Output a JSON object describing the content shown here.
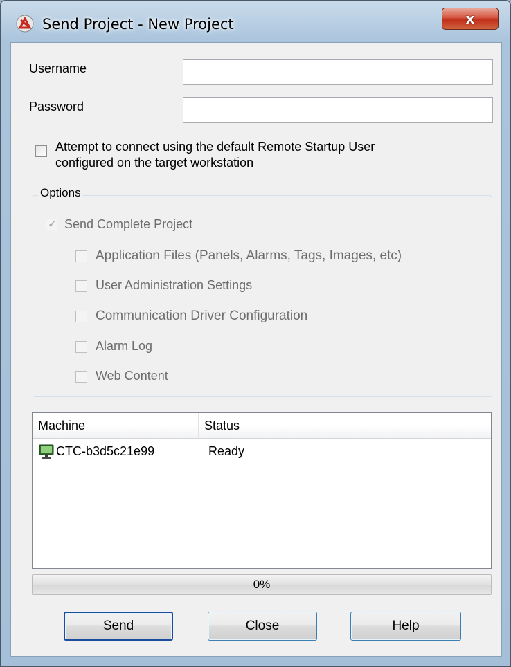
{
  "window": {
    "title": "Send Project - New Project",
    "close_label": "x"
  },
  "form": {
    "username_label": "Username",
    "username_value": "",
    "password_label": "Password",
    "password_value": "",
    "remote_startup_checkbox": {
      "checked": false,
      "label_line1": "Attempt to connect using the default Remote Startup User",
      "label_line2": "configured on the target workstation"
    }
  },
  "options": {
    "title": "Options",
    "send_complete": {
      "label": "Send Complete Project",
      "checked": true,
      "enabled": false
    },
    "items": [
      {
        "label": "Application Files (Panels, Alarms, Tags, Images, etc)",
        "checked": false
      },
      {
        "label": "User Administration Settings",
        "checked": false
      },
      {
        "label": "Communication Driver Configuration",
        "checked": false
      },
      {
        "label": "Alarm Log",
        "checked": false
      },
      {
        "label": "Web Content",
        "checked": false
      }
    ]
  },
  "machines": {
    "columns": [
      "Machine",
      "Status"
    ],
    "rows": [
      {
        "machine": "CTC-b3d5c21e99",
        "status": "Ready",
        "icon": "monitor-icon"
      }
    ]
  },
  "progress": {
    "value": 0,
    "text": "0%"
  },
  "buttons": {
    "send": "Send",
    "close": "Close",
    "help": "Help"
  },
  "colors": {
    "title_bar": "#aac4dc",
    "close_button": "#c1301b",
    "dialog_bg": "#f0f0f0",
    "button_border": "#3c7fb1",
    "disabled_text": "#6d6d6d"
  }
}
